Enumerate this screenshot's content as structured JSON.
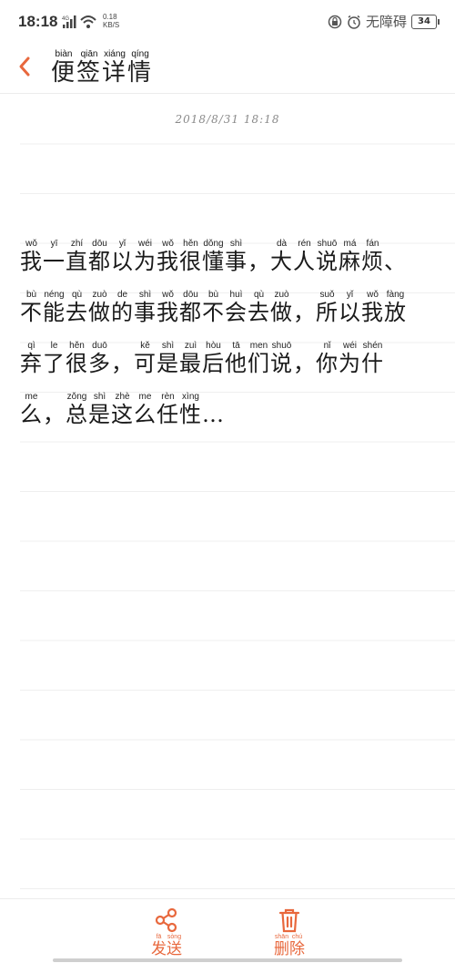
{
  "status": {
    "time": "18:18",
    "network": "4G",
    "speed_top": "0.18",
    "speed_bottom": "KB/S",
    "accessibility": "无障碍",
    "battery": "34"
  },
  "header": {
    "title": [
      {
        "c": "便",
        "p": "biàn"
      },
      {
        "c": "签",
        "p": "qiān"
      },
      {
        "c": "详",
        "p": "xiáng"
      },
      {
        "c": "情",
        "p": "qíng"
      }
    ]
  },
  "note": {
    "timestamp": "2018/8/31 18:18",
    "lines": [
      [
        {
          "c": "我",
          "p": "wǒ"
        },
        {
          "c": "一",
          "p": "yī"
        },
        {
          "c": "直",
          "p": "zhí"
        },
        {
          "c": "都",
          "p": "dōu"
        },
        {
          "c": "以",
          "p": "yǐ"
        },
        {
          "c": "为",
          "p": "wéi"
        },
        {
          "c": "我",
          "p": "wǒ"
        },
        {
          "c": "很",
          "p": "hěn"
        },
        {
          "c": "懂",
          "p": "dǒng"
        },
        {
          "c": "事",
          "p": "shì"
        },
        {
          "c": "，",
          "p": ""
        },
        {
          "c": "大",
          "p": "dà"
        },
        {
          "c": "人",
          "p": "rén"
        },
        {
          "c": "说",
          "p": "shuō"
        },
        {
          "c": "麻",
          "p": "má"
        },
        {
          "c": "烦",
          "p": "fán"
        },
        {
          "c": "、",
          "p": ""
        }
      ],
      [
        {
          "c": "不",
          "p": "bù"
        },
        {
          "c": "能",
          "p": "néng"
        },
        {
          "c": "去",
          "p": "qù"
        },
        {
          "c": "做",
          "p": "zuò"
        },
        {
          "c": "的",
          "p": "de"
        },
        {
          "c": "事",
          "p": "shì"
        },
        {
          "c": "我",
          "p": "wǒ"
        },
        {
          "c": "都",
          "p": "dōu"
        },
        {
          "c": "不",
          "p": "bù"
        },
        {
          "c": "会",
          "p": "huì"
        },
        {
          "c": "去",
          "p": "qù"
        },
        {
          "c": "做",
          "p": "zuò"
        },
        {
          "c": "，",
          "p": ""
        },
        {
          "c": "所",
          "p": "suǒ"
        },
        {
          "c": "以",
          "p": "yǐ"
        },
        {
          "c": "我",
          "p": "wǒ"
        },
        {
          "c": "放",
          "p": "fàng"
        }
      ],
      [
        {
          "c": "弃",
          "p": "qì"
        },
        {
          "c": "了",
          "p": "le"
        },
        {
          "c": "很",
          "p": "hěn"
        },
        {
          "c": "多",
          "p": "duō"
        },
        {
          "c": "，",
          "p": ""
        },
        {
          "c": "可",
          "p": "kě"
        },
        {
          "c": "是",
          "p": "shì"
        },
        {
          "c": "最",
          "p": "zuì"
        },
        {
          "c": "后",
          "p": "hòu"
        },
        {
          "c": "他",
          "p": "tā"
        },
        {
          "c": "们",
          "p": "men"
        },
        {
          "c": "说",
          "p": "shuō"
        },
        {
          "c": "，",
          "p": ""
        },
        {
          "c": "你",
          "p": "nǐ"
        },
        {
          "c": "为",
          "p": "wéi"
        },
        {
          "c": "什",
          "p": "shén"
        }
      ],
      [
        {
          "c": "么",
          "p": "me"
        },
        {
          "c": "，",
          "p": ""
        },
        {
          "c": "总",
          "p": "zǒng"
        },
        {
          "c": "是",
          "p": "shì"
        },
        {
          "c": "这",
          "p": "zhè"
        },
        {
          "c": "么",
          "p": "me"
        },
        {
          "c": "任",
          "p": "rèn"
        },
        {
          "c": "性",
          "p": "xìng"
        },
        {
          "c": "…",
          "p": ""
        }
      ]
    ]
  },
  "toolbar": {
    "send": [
      {
        "c": "发",
        "p": "fā"
      },
      {
        "c": "送",
        "p": "sòng"
      }
    ],
    "delete": [
      {
        "c": "删",
        "p": "shān"
      },
      {
        "c": "除",
        "p": "chú"
      }
    ]
  },
  "colors": {
    "accent": "#e8683d",
    "rule": "#efefef",
    "timestamp": "#8a8a8a"
  },
  "icons": {
    "back": "chevron-left-icon",
    "send": "share-icon",
    "delete": "trash-icon"
  }
}
